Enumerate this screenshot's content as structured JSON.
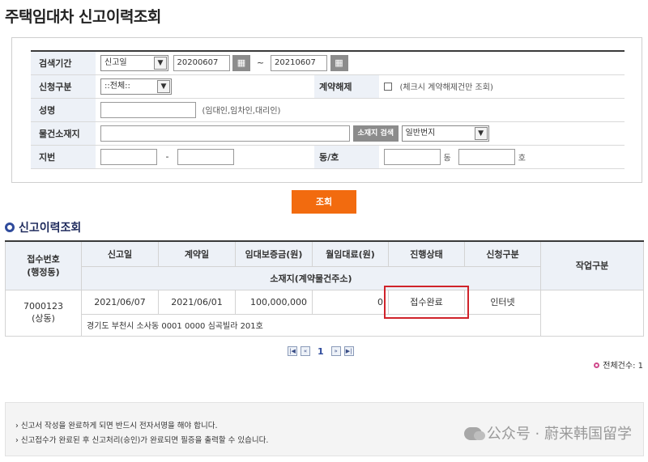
{
  "page": {
    "title": "주택임대차 신고이력조회"
  },
  "search": {
    "period_label": "검색기간",
    "period_type": "신고일",
    "date_from": "20200607",
    "date_sep": "~",
    "date_to": "20210607",
    "request_type_label": "신청구분",
    "request_type_value": "::전체::",
    "contract_cancel_label": "계약해제",
    "contract_cancel_hint": "(체크시 계약해제건만 조회)",
    "name_label": "성명",
    "name_value": "",
    "name_hint": "(임대인,임차인,대리인)",
    "location_label": "물건소재지",
    "location_value": "",
    "location_search_btn": "소재지 검색",
    "lot_type_value": "일반번지",
    "lot_label": "지번",
    "lot_sep": "-",
    "dong_ho_label": "동/호",
    "dong_suffix": "동",
    "ho_suffix": "호",
    "submit_label": "조회"
  },
  "results": {
    "section_title": "신고이력조회",
    "headers": {
      "receipt_no": "접수번호",
      "receipt_sub": "(행정동)",
      "report_date": "신고일",
      "contract_date": "계약일",
      "deposit": "임대보증금(원)",
      "monthly_rent": "월임대료(원)",
      "status": "진행상태",
      "request_type": "신청구분",
      "work_type": "작업구분",
      "address": "소재지(계약물건주소)"
    },
    "rows": [
      {
        "receipt_no": "7000123",
        "district": "(상동)",
        "report_date": "2021/06/07",
        "contract_date": "2021/06/01",
        "deposit": "100,000,000",
        "monthly_rent": "0",
        "status": "접수완료",
        "request_type": "인터넷",
        "work_type": "",
        "address": "경기도 부천시 소사동 0001 0000 심곡빌라 201호"
      }
    ],
    "highlight_color": "#d0232a"
  },
  "pager": {
    "current_page": "1"
  },
  "total": {
    "text": "전체건수: 1"
  },
  "notice": {
    "lines": [
      "› 신고서 작성을 완료하게 되면 반드시 전자서명을 해야 합니다.",
      "› 신고접수가 완료된 후 신고처리(승인)가 완료되면 필증을 출력할 수 있습니다."
    ],
    "watermark": "公众号 · 蔚来韩国留学"
  },
  "colors": {
    "accent": "#f26b0f",
    "section_title": "#1e2a5c",
    "header_bg": "#edf1f7"
  }
}
